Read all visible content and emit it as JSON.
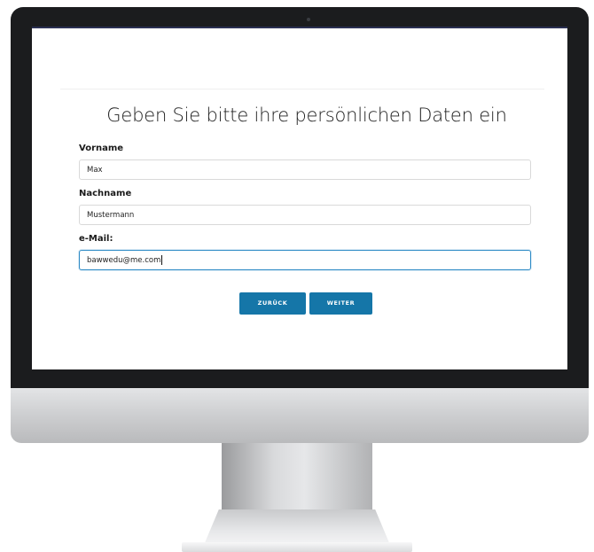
{
  "form": {
    "title": "Geben Sie bitte ihre persönlichen Daten ein",
    "fields": [
      {
        "label": "Vorname",
        "value": "Max"
      },
      {
        "label": "Nachname",
        "value": "Mustermann"
      },
      {
        "label": "e-Mail:",
        "value": "bawwedu@me.com"
      }
    ],
    "buttons": {
      "back_label": "ZURÜCK",
      "next_label": "WEITER"
    }
  },
  "colors": {
    "accent": "#1576a8",
    "focus_border": "#2f8bc6"
  }
}
